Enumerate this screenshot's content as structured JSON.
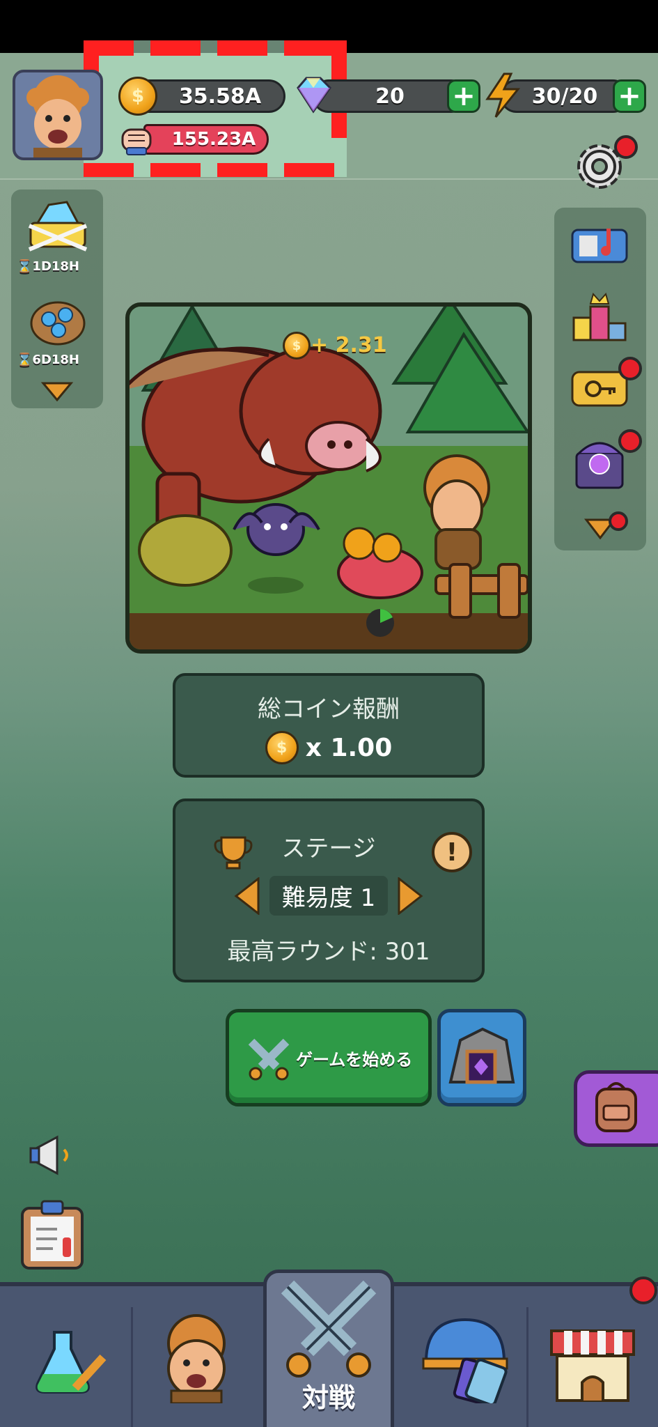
{
  "currency": {
    "coins": "35.58A",
    "power": "155.23A",
    "gems": "20",
    "energy": "30/20"
  },
  "timers": {
    "offer1": "1D18H",
    "offer2": "6D18H"
  },
  "scene": {
    "coin_gain": "+ 2.31"
  },
  "reward": {
    "title": "総コイン報酬",
    "multiplier": "x 1.00"
  },
  "stage": {
    "title": "ステージ",
    "difficulty": "難易度 1",
    "best_round": "最高ラウンド: 301"
  },
  "buttons": {
    "start": "ゲームを始める"
  },
  "nav": {
    "battle": "対戦"
  },
  "colors": {
    "accent_green": "#2e9a47",
    "alert_red": "#e8202a",
    "highlight_box": "#ff2020"
  }
}
